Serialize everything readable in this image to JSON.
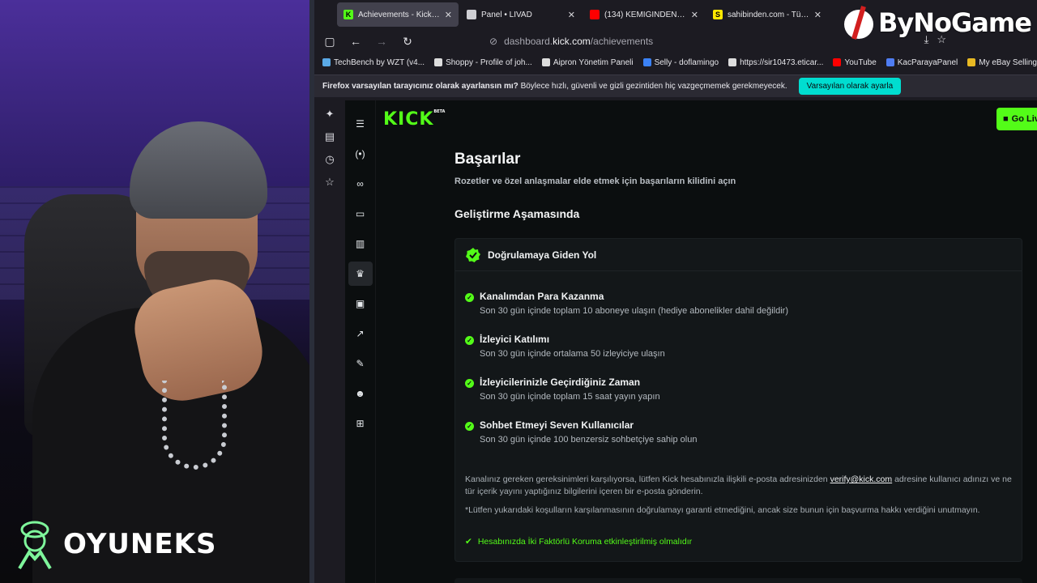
{
  "colors": {
    "kick_green": "#53fc18",
    "cta_cyan": "#00ddd0",
    "bg": "#0b0e0f"
  },
  "overlay": {
    "brand": "OYUNEKS",
    "watermark": "ByNoGame"
  },
  "tabs": [
    {
      "title": "Achievements - Kick Dashb",
      "icon": "kick-icon",
      "fav_color": "#53fc18",
      "fav_text": "K",
      "active": true
    },
    {
      "title": "Panel • LIVAD",
      "icon": "livad-icon",
      "fav_color": "#cfcfd4",
      "fav_text": "",
      "active": false
    },
    {
      "title": "(134) KEMIĞINDEN AYRIL/",
      "icon": "youtube-icon",
      "fav_color": "#ff0000",
      "fav_text": "",
      "active": false
    },
    {
      "title": "sahibinden.com - Türkiye'n",
      "icon": "sahibinden-icon",
      "fav_color": "#ffe800",
      "fav_text": "S",
      "active": false
    }
  ],
  "nav": {
    "url_prefix": "dashboard.",
    "url_domain": "kick.com",
    "url_path": "/achievements"
  },
  "bookmarks": [
    {
      "label": "TechBench by WZT (v4...",
      "icon": "techbench-icon",
      "color": "#5aa9e6"
    },
    {
      "label": "Shoppy - Profile of joh...",
      "icon": "shoppy-icon",
      "color": "#dddddd"
    },
    {
      "label": "Aipron Yönetim Paneli",
      "icon": "globe-icon",
      "color": "#dddddd"
    },
    {
      "label": "Selly - doflamingo",
      "icon": "selly-icon",
      "color": "#3b82f6"
    },
    {
      "label": "https://sir10473.eticar...",
      "icon": "globe-icon",
      "color": "#dddddd"
    },
    {
      "label": "YouTube",
      "icon": "youtube-icon",
      "color": "#ff0000"
    },
    {
      "label": "KacParayaPanel",
      "icon": "kacpara-icon",
      "color": "#4f7df3"
    },
    {
      "label": "My eBay Selling Overv...",
      "icon": "ebay-icon",
      "color": "#e8b923"
    }
  ],
  "notification": {
    "bold": "Firefox varsayılan tarayıcınız olarak ayarlansın mı?",
    "text": "Böylece hızlı, güvenli ve gizli gezintiden hiç vazgeçmemek gerekmeyecek.",
    "button": "Varsayılan olarak ayarla"
  },
  "kick": {
    "logo": "KICK",
    "beta": "BETA",
    "go_live": "Go Live"
  },
  "page": {
    "title": "Başarılar",
    "subtitle": "Rozetler ve özel anlaşmalar elde etmek için başarıların kilidini açın",
    "section": "Geliştirme Aşamasında",
    "card_title": "Doğrulamaya Giden Yol",
    "requirements": [
      {
        "title": "Kanalımdan Para Kazanma",
        "desc": "Son 30 gün içinde toplam 10 aboneye ulaşın (hediye abonelikler dahil değildir)"
      },
      {
        "title": "İzleyici Katılımı",
        "desc": "Son 30 gün içinde ortalama 50 izleyiciye ulaşın"
      },
      {
        "title": "İzleyicilerinizle Geçirdiğiniz Zaman",
        "desc": "Son 30 gün içinde toplam 15 saat yayın yapın"
      },
      {
        "title": "Sohbet Etmeyi Seven Kullanıcılar",
        "desc": "Son 30 gün içinde 100 benzersiz sohbetçiye sahip olun"
      }
    ],
    "note_before": "Kanalınız gereken gereksinimleri karşılıyorsa, lütfen Kick hesabınızla ilişkili e-posta adresinizden",
    "note_email": "verify@kick.com",
    "note_after": "adresine kullanıcı adınızı ve ne tür içerik yayını yaptığınız bilgilerini içeren bir e-posta gönderin.",
    "disclaimer": "*Lütfen yukarıdaki koşulların karşılanmasının doğrulamayı garanti etmediğini, ancak size bunun için başvurma hakkı verdiğini unutmayın.",
    "twofa": "Hesabınızda İki Faktörlü Koruma etkinleştirilmiş olmalıdır"
  }
}
